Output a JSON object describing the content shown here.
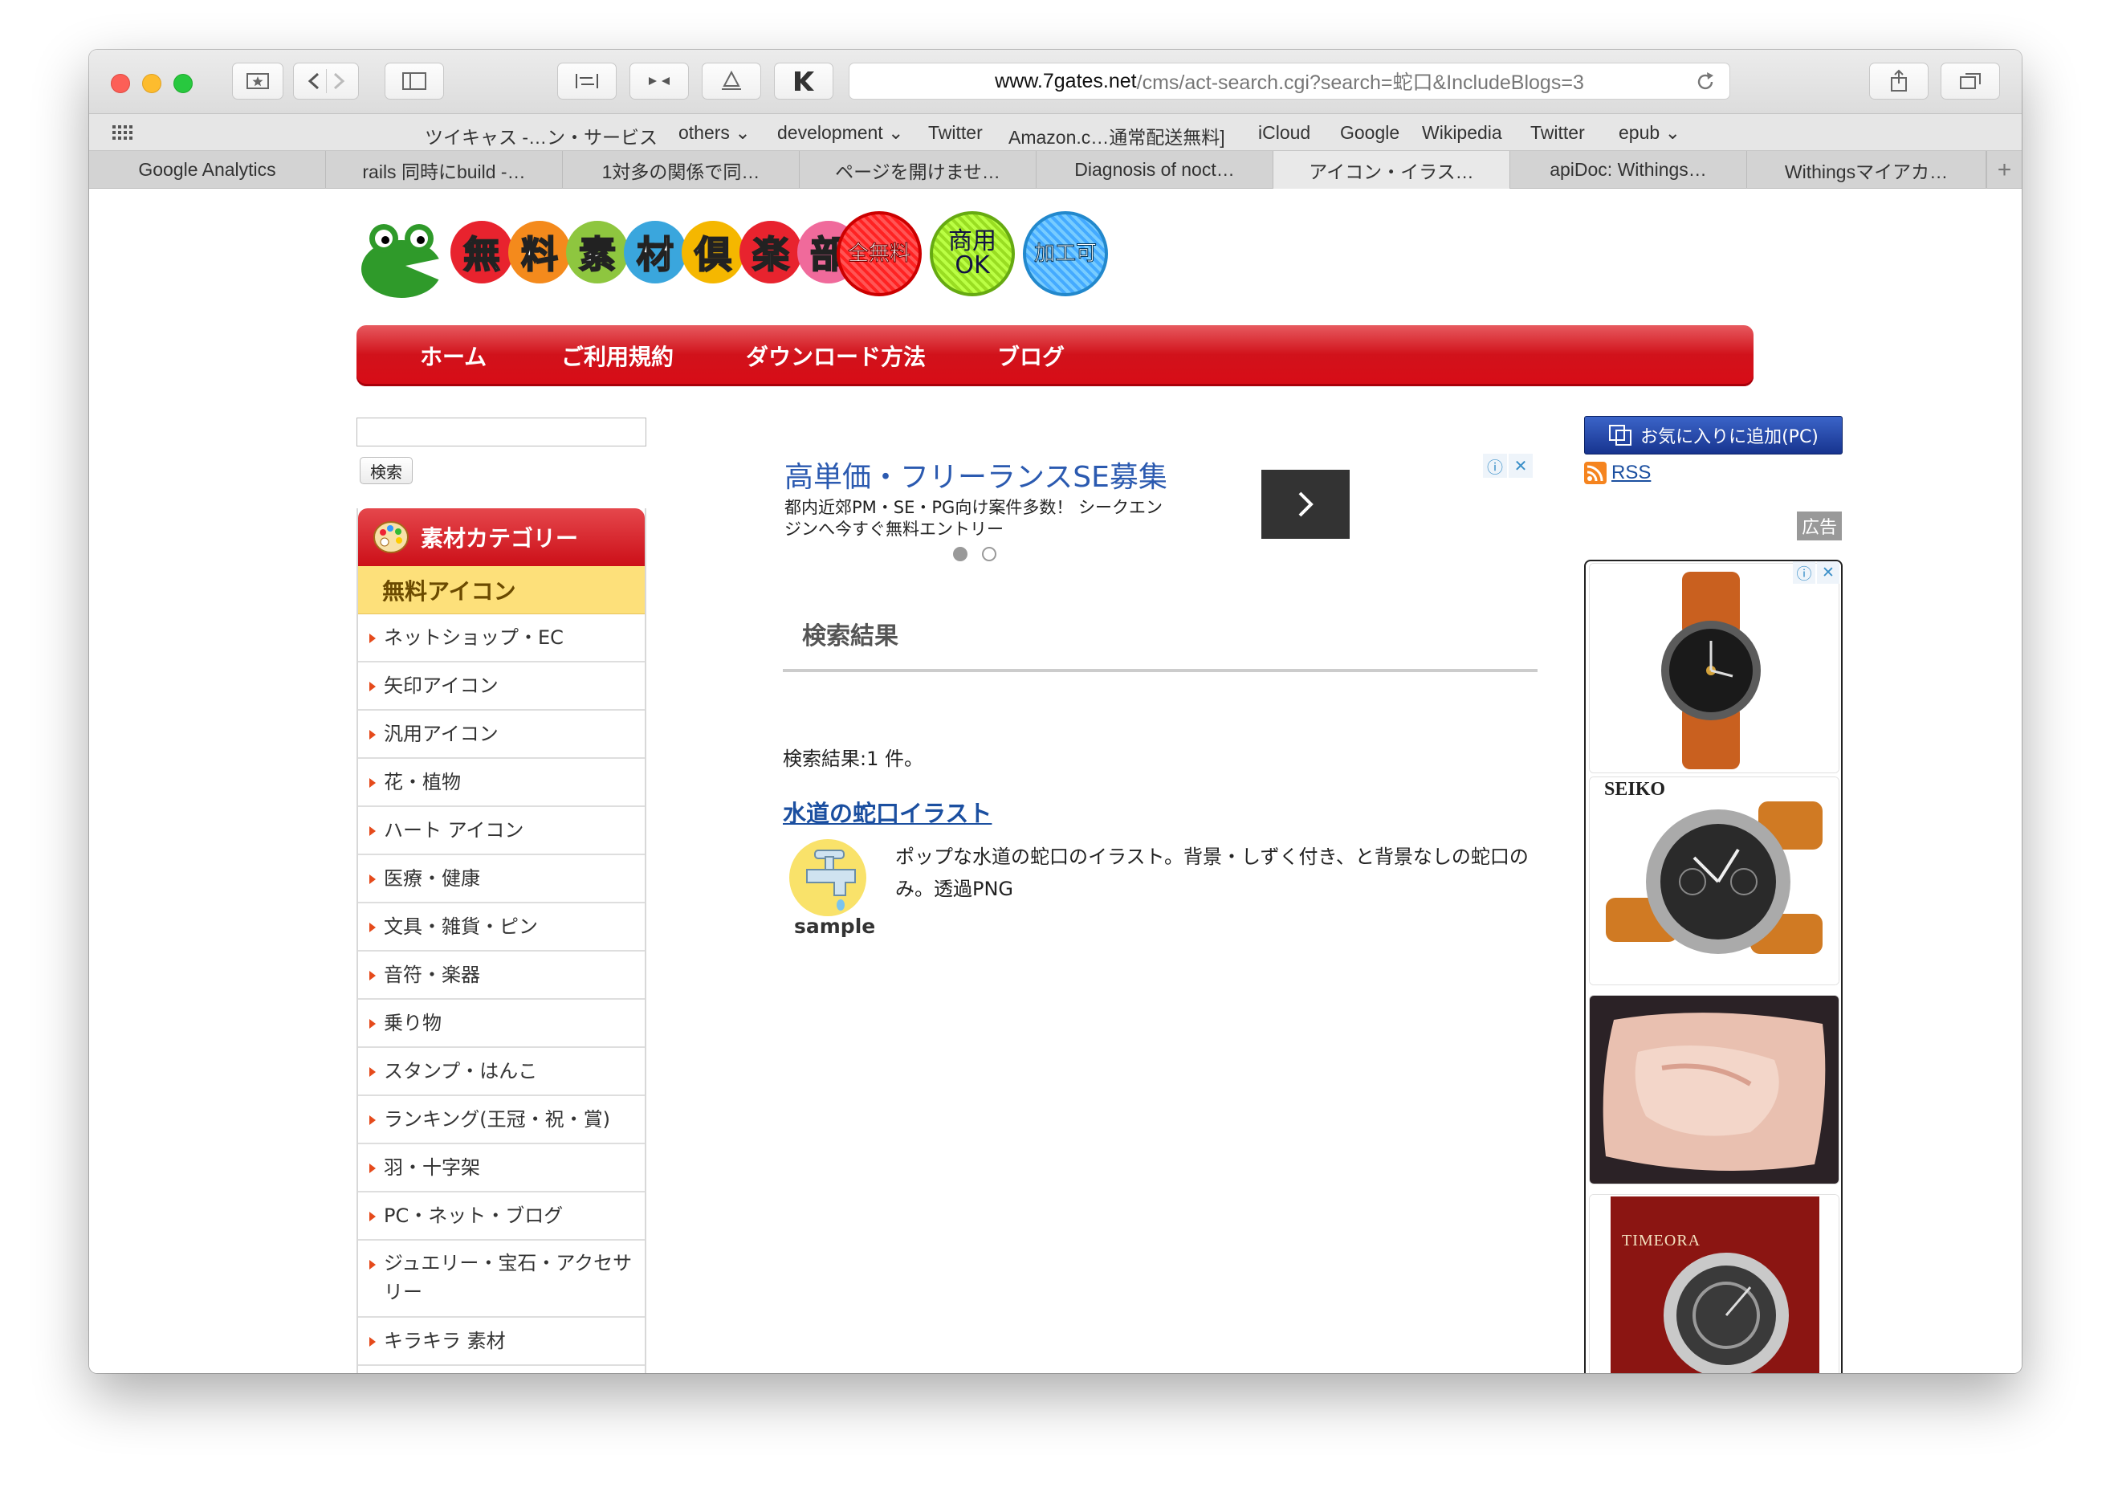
{
  "browser": {
    "url_host": "www.7gates.net",
    "url_path": "/cms/act-search.cgi?search=蛇口&IncludeBlogs=3",
    "bookmarks": [
      "ツイキャス -…ン・サービス",
      "others",
      "development",
      "Twitter",
      "Amazon.c…通常配送無料]",
      "iCloud",
      "Google",
      "Wikipedia",
      "Twitter",
      "epub"
    ],
    "tabs": [
      "Google Analytics",
      "rails 同時にbuild -…",
      "1対多の関係で同…",
      "ページを開けませ…",
      "Diagnosis of noct…",
      "アイコン・イラス…",
      "apiDoc: Withings…",
      "Withingsマイアカ…"
    ],
    "active_tab_index": 5
  },
  "site": {
    "logo_chars": [
      "無",
      "料",
      "素",
      "材",
      "倶",
      "楽",
      "部"
    ],
    "logo_colors": [
      "#e8232e",
      "#f48a1c",
      "#8ec63f",
      "#3aa6dd",
      "#f5b700",
      "#e8232e",
      "#f06a9b"
    ],
    "badges": [
      "全無料",
      "商用OK",
      "加工可"
    ],
    "nav": [
      "ホーム",
      "ご利用規約",
      "ダウンロード方法",
      "ブログ"
    ]
  },
  "sidebar": {
    "search_button": "検索",
    "category_title": "素材カテゴリー",
    "category_sub": "無料アイコン",
    "items": [
      "ネットショップ・EC",
      "矢印アイコン",
      "汎用アイコン",
      "花・植物",
      "ハート アイコン",
      "医療・健康",
      "文具・雑貨・ピン",
      "音符・楽器",
      "乗り物",
      "スタンプ・はんこ",
      "ランキング(王冠・祝・賞)",
      "羽・十字架",
      "PC・ネット・ブログ",
      "ジュエリー・宝石・アクセサリー",
      "キラキラ 素材"
    ]
  },
  "ad": {
    "title": "高単価・フリーランスSE募集",
    "description": "都内近郊PM・SE・PG向け案件多数！ シークエンジンへ今すぐ無料エントリー"
  },
  "results": {
    "heading": "検索結果",
    "count_text": "検索結果:1 件。",
    "items": [
      {
        "title": "水道の蛇口イラスト",
        "description": "ポップな水道の蛇口のイラスト。背景・しずく付き、と背景なしの蛇口のみ。透過PNG",
        "thumb_label": "sample"
      }
    ]
  },
  "right": {
    "favorite_button": "お気に入りに追加(PC)",
    "rss_label": "RSS",
    "ad_label": "広告",
    "product_labels": [
      "SEIKO",
      "TIMEORA"
    ]
  }
}
